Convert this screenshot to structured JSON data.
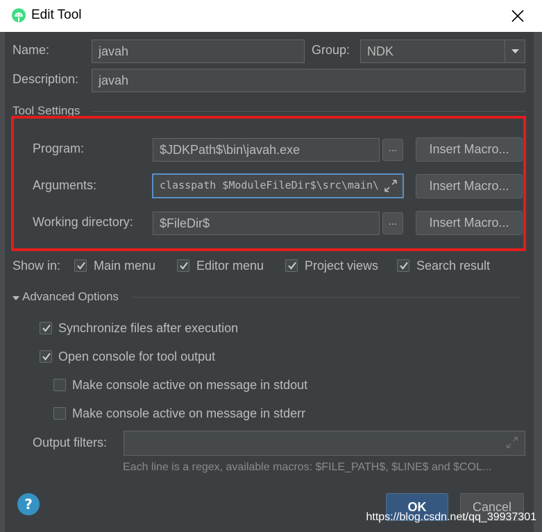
{
  "window": {
    "title": "Edit Tool"
  },
  "form": {
    "name_label": "Name:",
    "name_value": "javah",
    "group_label": "Group:",
    "group_value": "NDK",
    "description_label": "Description:",
    "description_value": "javah"
  },
  "tool_settings": {
    "title": "Tool Settings",
    "program_label": "Program:",
    "program_value": "$JDKPath$\\bin\\javah.exe",
    "arguments_label": "Arguments:",
    "arguments_value": "classpath $ModuleFileDir$\\src\\main\\",
    "working_dir_label": "Working directory:",
    "working_dir_value": "$FileDir$",
    "browse_label": "...",
    "insert_macro_label": "Insert Macro..."
  },
  "show_in": {
    "label": "Show in:",
    "options": [
      {
        "label": "Main menu",
        "checked": true
      },
      {
        "label": "Editor menu",
        "checked": true
      },
      {
        "label": "Project views",
        "checked": true
      },
      {
        "label": "Search result",
        "checked": true
      }
    ]
  },
  "advanced": {
    "title": "Advanced Options",
    "sync_files": {
      "label": "Synchronize files after execution",
      "checked": true
    },
    "open_console": {
      "label": "Open console for tool output",
      "checked": true
    },
    "console_stdout": {
      "label": "Make console active on message in stdout",
      "checked": false
    },
    "console_stderr": {
      "label": "Make console active on message in stderr",
      "checked": false
    },
    "output_filters_label": "Output filters:",
    "output_filters_value": "",
    "hint": "Each line is a regex, available macros: $FILE_PATH$, $LINE$ and $COL..."
  },
  "buttons": {
    "help": "?",
    "ok": "OK",
    "cancel": "Cancel"
  },
  "watermark": "https://blog.csdn.net/qq_39937301",
  "colors": {
    "background": "#3c3f41",
    "highlight": "#e31c1c",
    "ok_button": "#365880"
  },
  "icons": [
    "android-icon",
    "close-icon",
    "dropdown-arrow-icon",
    "expand-icon",
    "check-icon",
    "triangle-down-icon",
    "help-icon"
  ]
}
